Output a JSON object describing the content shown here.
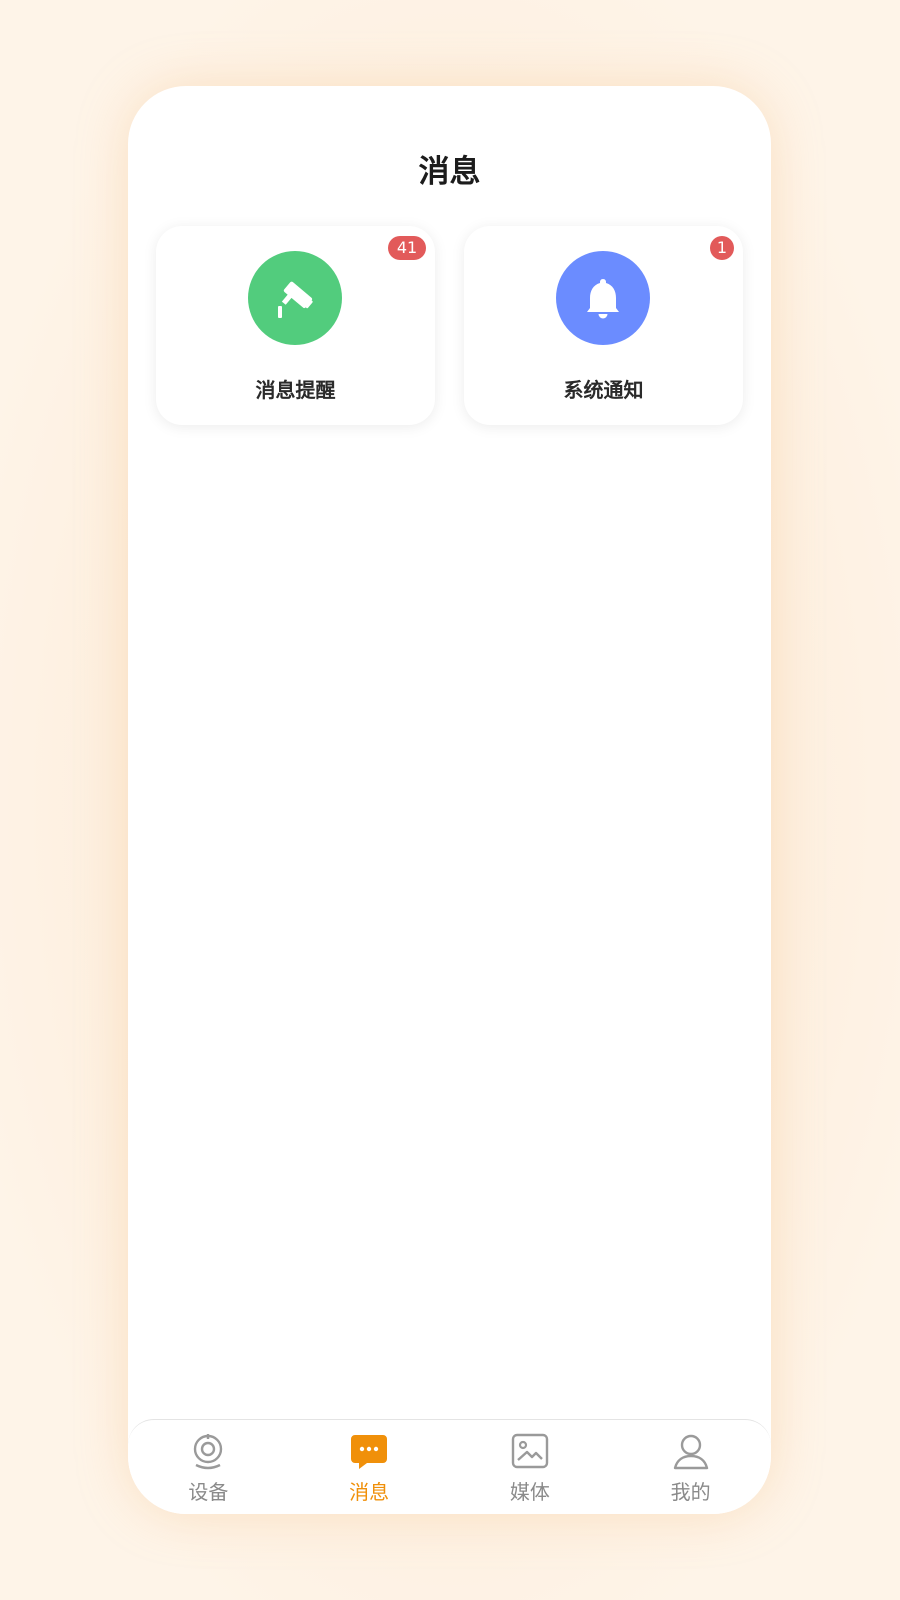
{
  "header": {
    "title": "消息"
  },
  "cards": [
    {
      "label": "消息提醒",
      "badge": "41",
      "icon": "camera-icon",
      "color": "#52cc7d"
    },
    {
      "label": "系统通知",
      "badge": "1",
      "icon": "bell-icon",
      "color": "#6b8cff"
    }
  ],
  "tabs": [
    {
      "label": "设备",
      "icon": "webcam-icon",
      "active": false
    },
    {
      "label": "消息",
      "icon": "chat-icon",
      "active": true
    },
    {
      "label": "媒体",
      "icon": "image-icon",
      "active": false
    },
    {
      "label": "我的",
      "icon": "user-icon",
      "active": false
    }
  ],
  "colors": {
    "accent": "#f0900a",
    "badge": "#e25a5a",
    "inactive": "#8a8a8a",
    "background": "#fdf1e2"
  }
}
